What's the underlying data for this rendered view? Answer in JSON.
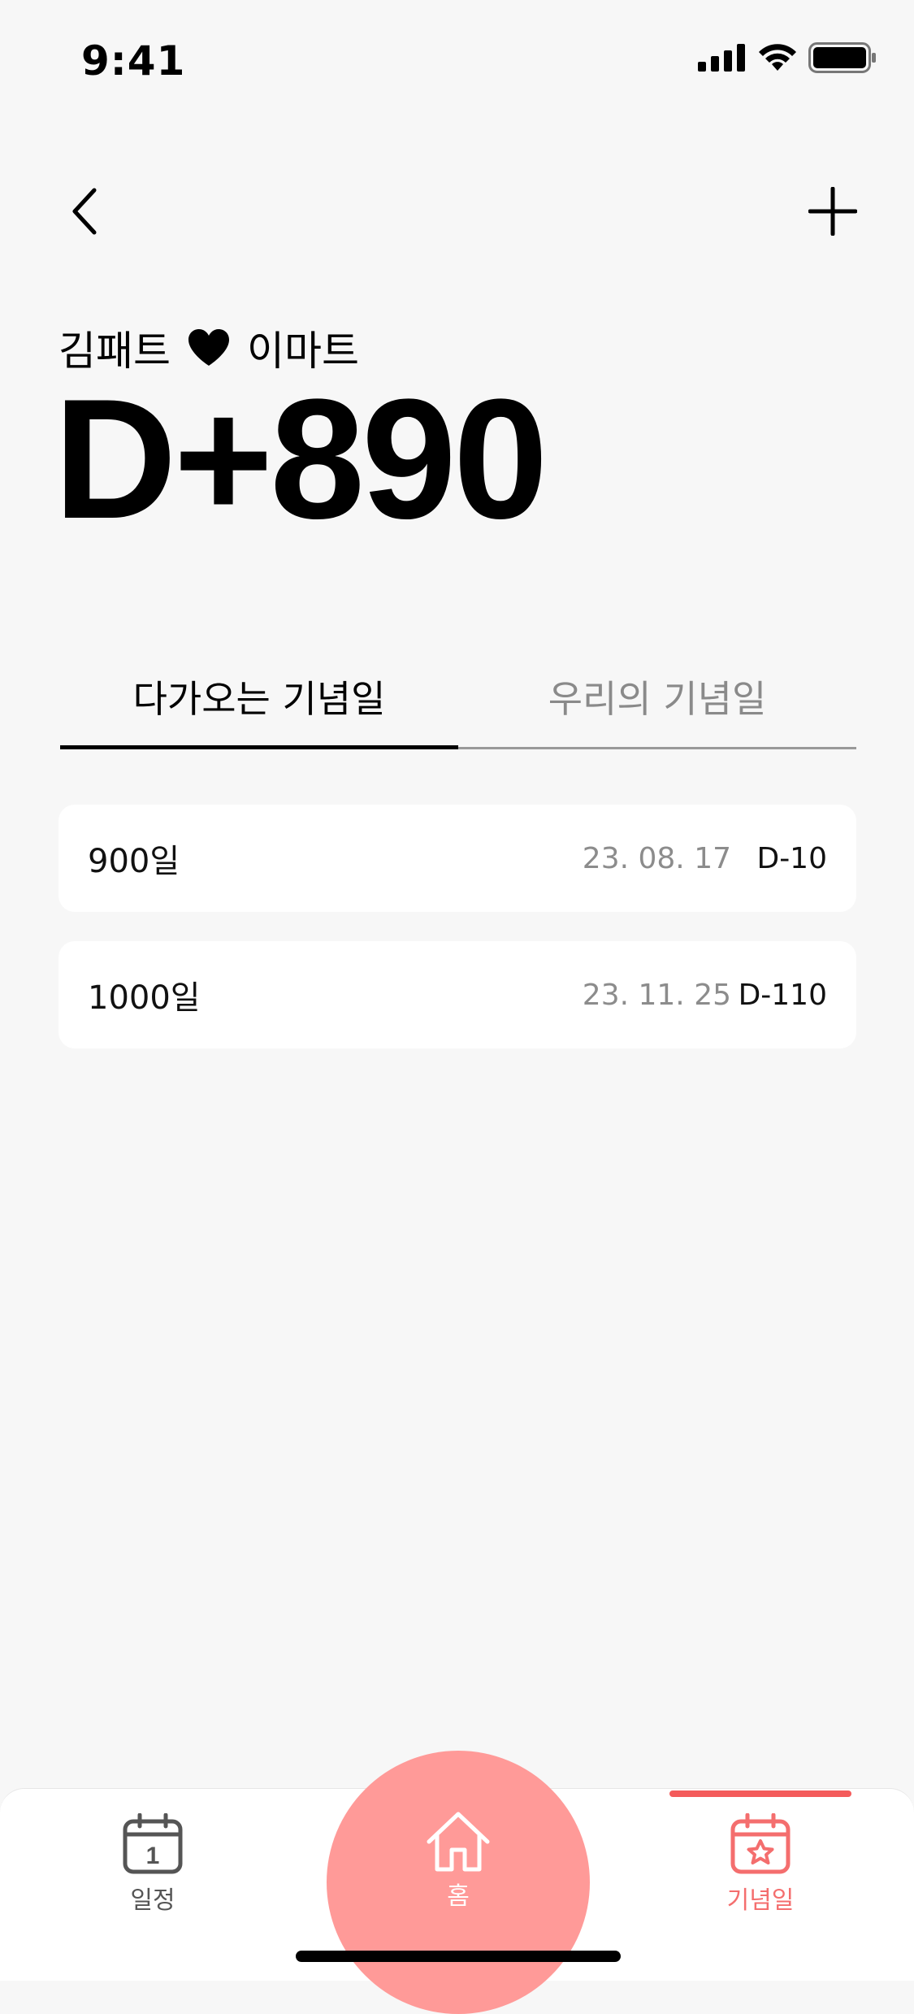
{
  "status_bar": {
    "time": "9:41"
  },
  "header": {
    "left_name": "김패트",
    "right_name": "이마트",
    "dday": "D+890"
  },
  "tabs": [
    {
      "label": "다가오는 기념일",
      "active": true
    },
    {
      "label": "우리의 기념일",
      "active": false
    }
  ],
  "anniversaries": [
    {
      "name": "900일",
      "date": "23. 08. 17",
      "dday": "D-10"
    },
    {
      "name": "1000일",
      "date": "23. 11. 25",
      "dday": "D-110"
    }
  ],
  "tab_bar": {
    "schedule_label": "일정",
    "schedule_icon_number": "1",
    "home_label": "홈",
    "anniversary_label": "기념일"
  },
  "colors": {
    "accent": "#ff9a98",
    "active_tab": "#f46e6e",
    "background": "#f7f7f7"
  }
}
